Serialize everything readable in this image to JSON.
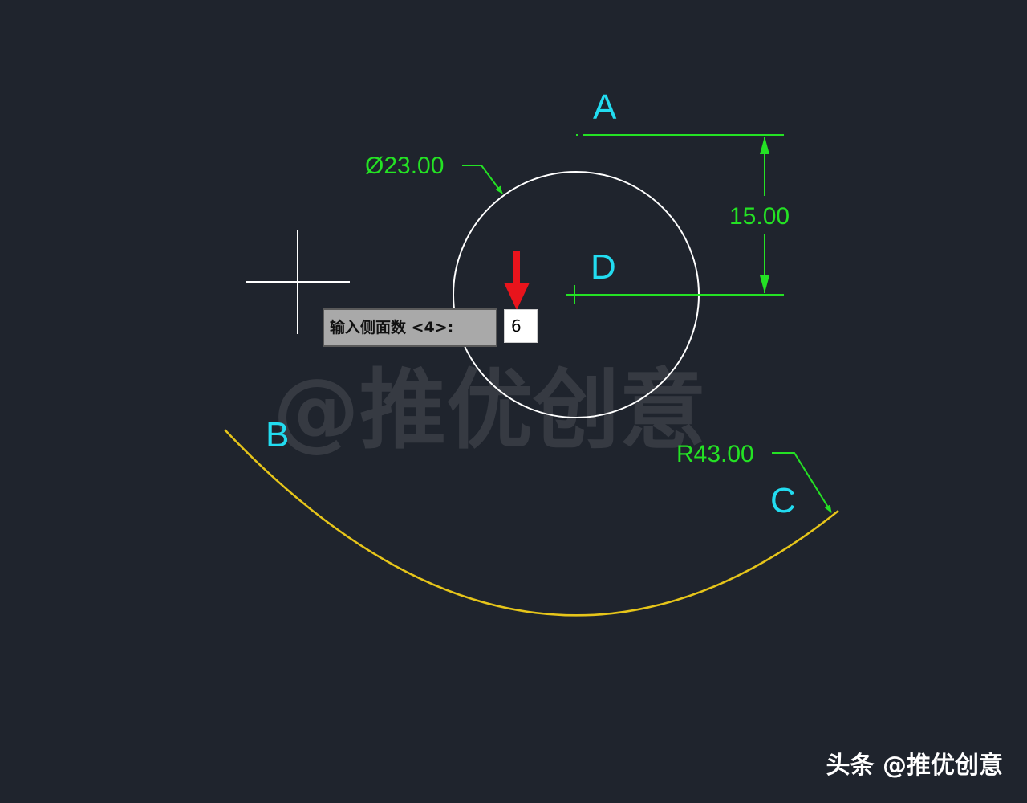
{
  "canvas": {
    "background_color": "#1f242d",
    "points": [
      {
        "id": "A",
        "label": "A",
        "color": "#22dcf0"
      },
      {
        "id": "B",
        "label": "B",
        "color": "#22dcf0"
      },
      {
        "id": "C",
        "label": "C",
        "color": "#22dcf0"
      },
      {
        "id": "D",
        "label": "D",
        "color": "#22dcf0"
      }
    ],
    "dimensions": {
      "diameter": {
        "text": "Ø23.00",
        "color": "#24e224"
      },
      "vertical": {
        "text": "15.00",
        "color": "#24e224"
      },
      "radius": {
        "text": "R43.00",
        "color": "#24e224"
      }
    },
    "colors": {
      "circle": "#ffffff",
      "arc": "#e6c51a",
      "dimension": "#24e224",
      "arrow_marker": "#e8141c",
      "crosshair": "#ffffff"
    },
    "watermark": "@推优创意"
  },
  "command": {
    "prompt": "输入侧面数 <4>:",
    "input_value": "6"
  },
  "footer": {
    "credit": "头条 @推优创意"
  }
}
